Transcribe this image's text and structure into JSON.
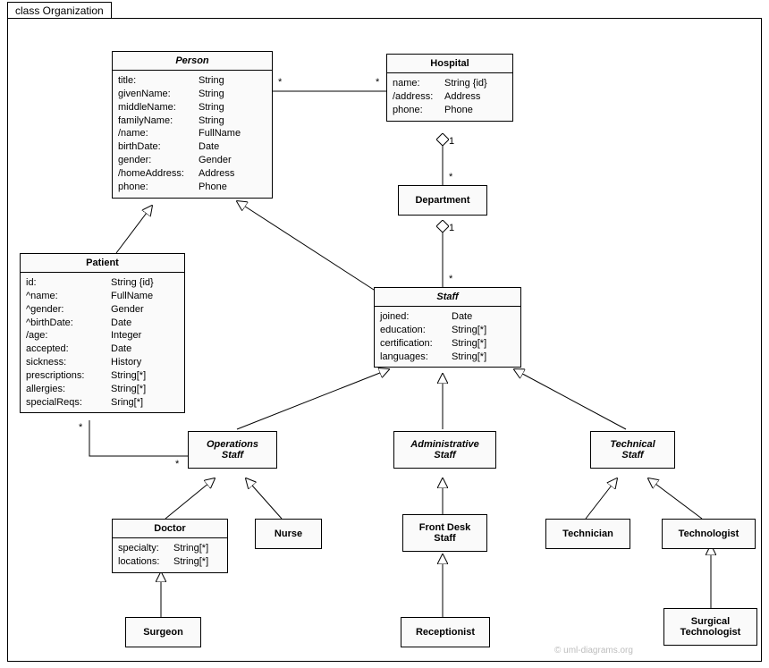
{
  "package": {
    "name": "class Organization"
  },
  "watermark": "© uml-diagrams.org",
  "mult": {
    "star": "*",
    "one": "1"
  },
  "classes": {
    "person": {
      "name": "Person",
      "attrs": [
        {
          "n": "title:",
          "t": "String"
        },
        {
          "n": "givenName:",
          "t": "String"
        },
        {
          "n": "middleName:",
          "t": "String"
        },
        {
          "n": "familyName:",
          "t": "String"
        },
        {
          "n": "/name:",
          "t": "FullName"
        },
        {
          "n": "birthDate:",
          "t": "Date"
        },
        {
          "n": "gender:",
          "t": "Gender"
        },
        {
          "n": "/homeAddress:",
          "t": "Address"
        },
        {
          "n": "phone:",
          "t": "Phone"
        }
      ]
    },
    "hospital": {
      "name": "Hospital",
      "attrs": [
        {
          "n": "name:",
          "t": "String {id}"
        },
        {
          "n": "/address:",
          "t": "Address"
        },
        {
          "n": "phone:",
          "t": "Phone"
        }
      ]
    },
    "department": {
      "name": "Department"
    },
    "patient": {
      "name": "Patient",
      "attrs": [
        {
          "n": "id:",
          "t": "String {id}"
        },
        {
          "n": "^name:",
          "t": "FullName"
        },
        {
          "n": "^gender:",
          "t": "Gender"
        },
        {
          "n": "^birthDate:",
          "t": "Date"
        },
        {
          "n": "/age:",
          "t": "Integer"
        },
        {
          "n": "accepted:",
          "t": "Date"
        },
        {
          "n": "sickness:",
          "t": "History"
        },
        {
          "n": "prescriptions:",
          "t": "String[*]"
        },
        {
          "n": "allergies:",
          "t": "String[*]"
        },
        {
          "n": "specialReqs:",
          "t": "Sring[*]"
        }
      ]
    },
    "staff": {
      "name": "Staff",
      "attrs": [
        {
          "n": "joined:",
          "t": "Date"
        },
        {
          "n": "education:",
          "t": "String[*]"
        },
        {
          "n": "certification:",
          "t": "String[*]"
        },
        {
          "n": "languages:",
          "t": "String[*]"
        }
      ]
    },
    "opsStaff": {
      "name": "Operations\nStaff"
    },
    "adminStaff": {
      "name": "Administrative\nStaff"
    },
    "techStaff": {
      "name": "Technical\nStaff"
    },
    "doctor": {
      "name": "Doctor",
      "attrs": [
        {
          "n": "specialty:",
          "t": "String[*]"
        },
        {
          "n": "locations:",
          "t": "String[*]"
        }
      ]
    },
    "nurse": {
      "name": "Nurse"
    },
    "frontDesk": {
      "name": "Front Desk\nStaff"
    },
    "technician": {
      "name": "Technician"
    },
    "technologist": {
      "name": "Technologist"
    },
    "surgeon": {
      "name": "Surgeon"
    },
    "receptionist": {
      "name": "Receptionist"
    },
    "surgTech": {
      "name": "Surgical\nTechnologist"
    }
  }
}
